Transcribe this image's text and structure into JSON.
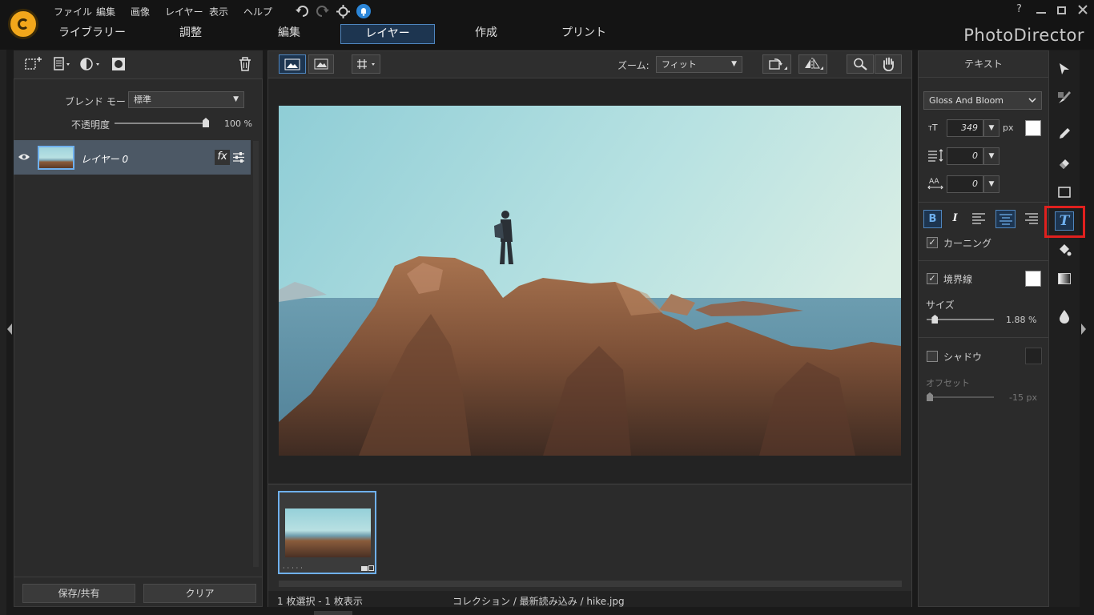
{
  "app": {
    "brand": "PhotoDirector"
  },
  "menu": [
    "ファイル",
    "編集",
    "画像",
    "レイヤー",
    "表示",
    "ヘルプ"
  ],
  "help_glyph": "?",
  "tabs": [
    "ライブラリー",
    "調整",
    "編集",
    "レイヤー",
    "作成",
    "プリント"
  ],
  "active_tab": "レイヤー",
  "left_panel": {
    "blend_label": "ブレンド モード:",
    "blend_value": "標準",
    "opacity_label": "不透明度",
    "opacity_value": "100 %",
    "opacity_level": 1.0,
    "layer_name": "レイヤー 0",
    "fx_label": "fx",
    "save_share": "保存/共有",
    "clear": "クリア"
  },
  "center": {
    "zoom_label": "ズーム:",
    "zoom_value": "フィット",
    "status_left": "1 枚選択 - 1 枚表示",
    "status_path": "コレクション / 最新読み込み / hike.jpg"
  },
  "right_panel": {
    "title": "テキスト",
    "font": "Gloss And Bloom",
    "size_value": "349",
    "size_unit": "px",
    "line_spacing": "0",
    "char_spacing": "0",
    "bold": "B",
    "italic": "I",
    "kerning": "カーニング",
    "border": "境界線",
    "size_label": "サイズ",
    "border_size": "1.88 %",
    "border_size_level": 0.1,
    "shadow": "シャドウ",
    "offset_label": "オフセット",
    "offset_value": "-15 px",
    "offset_level": 0.0
  },
  "colors": {
    "accent": "#4f86bf",
    "highlight_red": "#e0201e",
    "bg": "#2b2b2b"
  },
  "icons": [
    "undo-icon",
    "redo-icon",
    "gear-icon",
    "notification-icon",
    "eye-icon",
    "trash-icon",
    "select-arrow-icon",
    "brush-icon",
    "pencil-icon",
    "eraser-icon",
    "rectangle-icon",
    "text-tool-icon",
    "paint-bucket-icon",
    "gradient-icon",
    "water-drop-icon",
    "zoom-icon",
    "hand-icon"
  ]
}
